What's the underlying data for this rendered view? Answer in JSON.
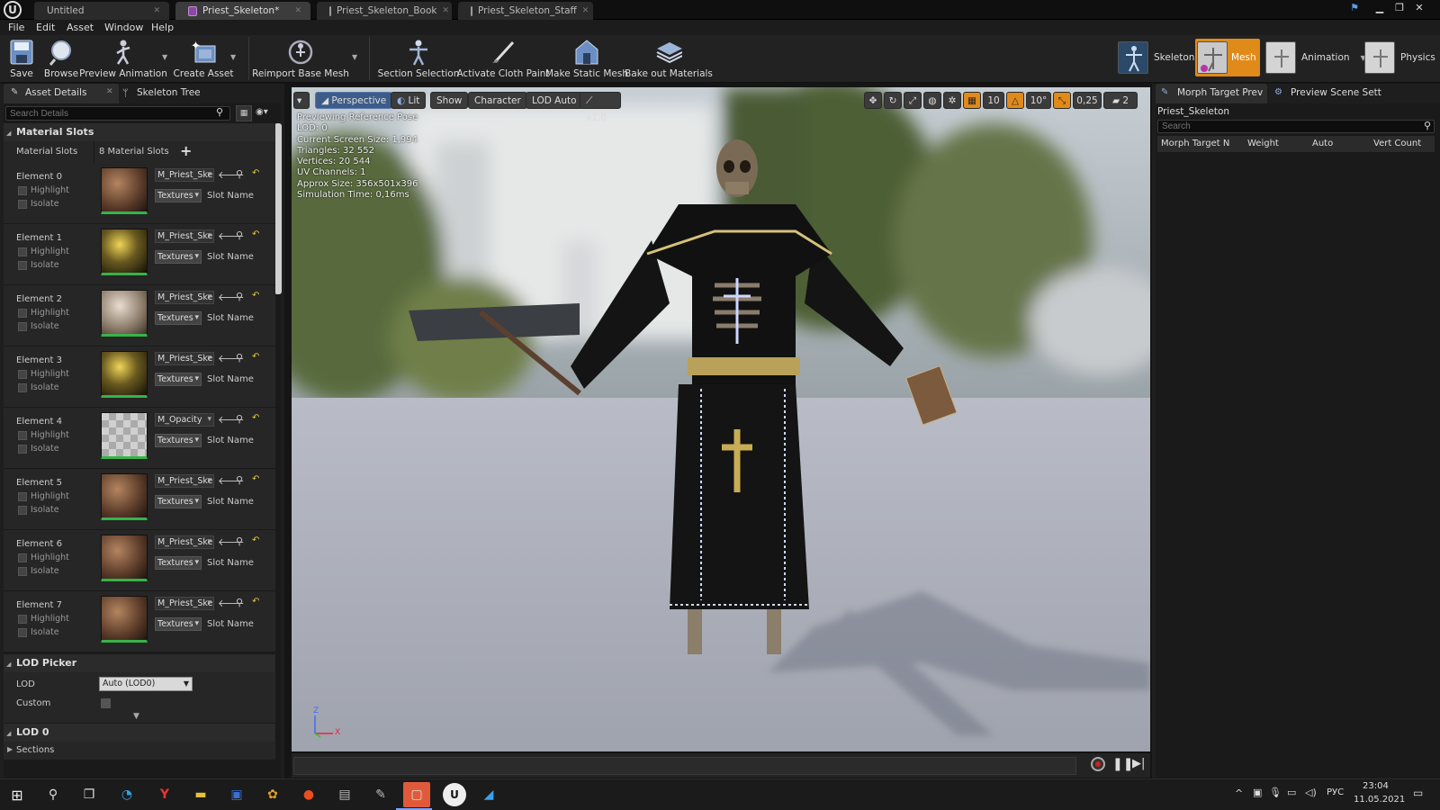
{
  "titlebar": {
    "tabs": [
      {
        "label": "Untitled"
      },
      {
        "label": "Priest_Skeleton*"
      },
      {
        "label": "Priest_Skeleton_Book"
      },
      {
        "label": "Priest_Skeleton_Staff"
      }
    ],
    "logo": "U"
  },
  "menu": [
    "File",
    "Edit",
    "Asset",
    "Window",
    "Help"
  ],
  "toolbar": {
    "save": "Save",
    "browse": "Browse",
    "preview_animation": "Preview Animation",
    "create_asset": "Create Asset",
    "reimport": "Reimport Base Mesh",
    "section_selection": "Section Selection",
    "activate_cloth": "Activate Cloth Paint",
    "make_static": "Make Static Mesh",
    "bake_out": "Bake out Materials"
  },
  "modes": {
    "skeleton": "Skeleton",
    "mesh": "Mesh",
    "animation": "Animation",
    "physics": "Physics"
  },
  "left": {
    "tab_asset_details": "Asset Details",
    "tab_skeleton_tree": "Skeleton Tree",
    "search_placeholder": "Search Details",
    "material_slots_header": "Material Slots",
    "material_slots_label": "Material Slots",
    "material_slots_count": "8 Material Slots",
    "highlight": "Highlight",
    "isolate": "Isolate",
    "textures": "Textures",
    "slot_name": "Slot Name",
    "elements": [
      {
        "name": "Element 0",
        "material": "M_Priest_Ske"
      },
      {
        "name": "Element 1",
        "material": "M_Priest_Ske"
      },
      {
        "name": "Element 2",
        "material": "M_Priest_Ske"
      },
      {
        "name": "Element 3",
        "material": "M_Priest_Ske"
      },
      {
        "name": "Element 4",
        "material": "M_Opacity"
      },
      {
        "name": "Element 5",
        "material": "M_Priest_Ske"
      },
      {
        "name": "Element 6",
        "material": "M_Priest_Ske"
      },
      {
        "name": "Element 7",
        "material": "M_Priest_Ske"
      }
    ],
    "lod_picker_header": "LOD Picker",
    "lod_label": "LOD",
    "lod_value": "Auto (LOD0)",
    "custom_label": "Custom",
    "lod0_header": "LOD 0",
    "sections_label": "Sections"
  },
  "viewport": {
    "perspective": "Perspective",
    "lit": "Lit",
    "show": "Show",
    "character": "Character",
    "lod_auto": "LOD Auto",
    "speed": "x1,0",
    "grid_snap": "10",
    "rot_snap": "10°",
    "scale_snap": "0,25",
    "cam_speed": "2",
    "stats": [
      "Previewing Reference Pose",
      "LOD: 0",
      "Current Screen Size: 1,994",
      "Triangles: 32 552",
      "Vertices: 20 544",
      "UV Channels: 1",
      "Approx Size: 356x501x396",
      "Simulation Time: 0,16ms"
    ],
    "axis_z": "Z",
    "axis_x": "X"
  },
  "right": {
    "tab_morph": "Morph Target Prev",
    "tab_scene": "Preview Scene Sett",
    "asset_name": "Priest_Skeleton",
    "search_placeholder": "Search",
    "columns": [
      "Morph Target N",
      "Weight",
      "Auto",
      "Vert Count"
    ]
  },
  "taskbar": {
    "lang": "РУС",
    "time": "23:04",
    "date": "11.05.2021"
  },
  "colors": {
    "accent_orange": "#e08a1a",
    "thumb_green": "#36b34a",
    "bg_dark": "#1e1e1e"
  }
}
